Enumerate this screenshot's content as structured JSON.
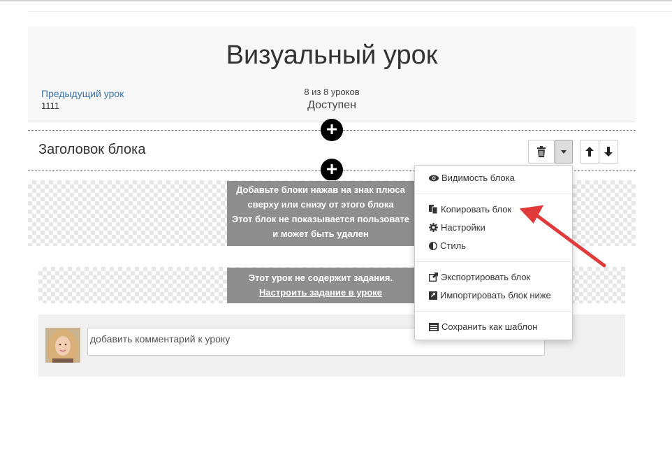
{
  "lesson": {
    "title": "Визуальный урок",
    "prev_label": "Предыдущий урок",
    "prev_name": "1111",
    "count": "8 из 8 уроков",
    "status": "Доступен"
  },
  "block": {
    "title": "Заголовок блока",
    "plus": "+"
  },
  "empty_block": {
    "line1": "Добавьте блоки нажав на знак плюса",
    "line2": "сверху или снизу от этого блока",
    "line3": "Этот блок не показывается пользовате",
    "line4": "и может быть удален"
  },
  "task": {
    "line1": "Этот урок не содержит задания.",
    "link": "Настроить задание в уроке"
  },
  "comment": {
    "placeholder": "добавить комментарий к уроку"
  },
  "menu": {
    "items": [
      {
        "label": "Видимость блока",
        "icon": "eye-icon"
      },
      {
        "label": "Копировать блок",
        "icon": "copy-icon"
      },
      {
        "label": "Настройки",
        "icon": "gear-icon"
      },
      {
        "label": "Стиль",
        "icon": "contrast-icon"
      },
      {
        "label": "Экспортировать блок",
        "icon": "external-link-icon"
      },
      {
        "label": "Импортировать блок ниже",
        "icon": "import-icon"
      },
      {
        "label": "Сохранить как шаблон",
        "icon": "template-icon"
      }
    ]
  },
  "colors": {
    "link": "#3a73a8",
    "arrow": "#e03a3a",
    "graybox": "#8e8e8e"
  }
}
